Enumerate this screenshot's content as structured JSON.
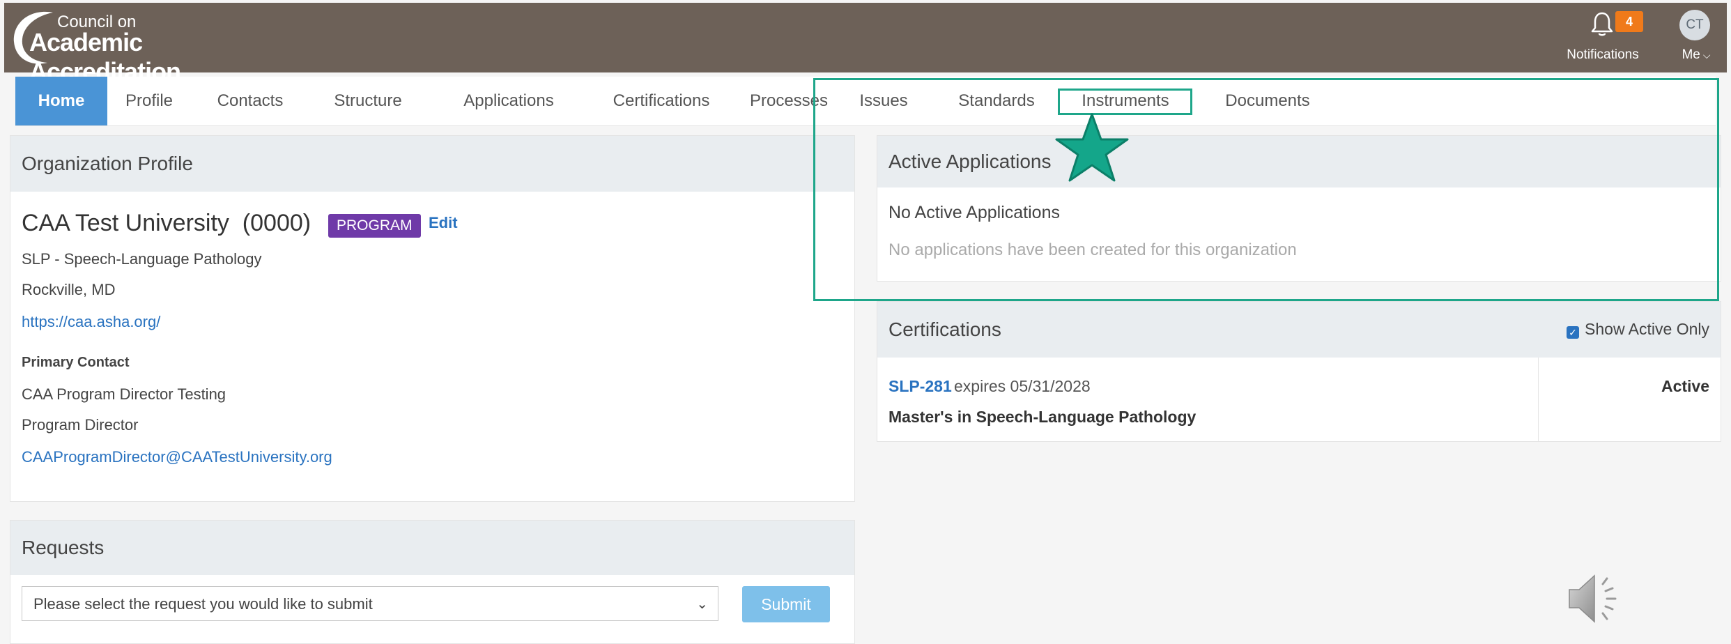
{
  "header": {
    "logo_line1": "Council on",
    "logo_line2": "Academic Accreditation",
    "notifications": {
      "count": "4",
      "label": "Notifications",
      "icon": "bell-icon"
    },
    "user": {
      "initials": "CT",
      "label": "Me"
    }
  },
  "nav": {
    "tabs": [
      {
        "label": "Home",
        "active": true
      },
      {
        "label": "Profile"
      },
      {
        "label": "Contacts"
      },
      {
        "label": "Structure"
      },
      {
        "label": "Applications"
      },
      {
        "label": "Certifications"
      },
      {
        "label": "Processes"
      },
      {
        "label": "Issues"
      },
      {
        "label": "Standards"
      },
      {
        "label": "Instruments"
      },
      {
        "label": "Documents"
      }
    ]
  },
  "org_profile": {
    "title": "Organization Profile",
    "name": "CAA Test University  (0000)",
    "badge": "PROGRAM",
    "edit_label": "Edit",
    "program": "SLP - Speech-Language Pathology",
    "location": "Rockville, MD",
    "url": "https://caa.asha.org/",
    "primary_contact_label": "Primary Contact",
    "contact_name": "CAA Program Director Testing",
    "contact_title": "Program Director",
    "contact_email": "CAAProgramDirector@CAATestUniversity.org"
  },
  "requests": {
    "title": "Requests",
    "select_value": "Please select the request you would like to submit",
    "submit_label": "Submit"
  },
  "active_applications": {
    "title": "Active Applications",
    "empty_title": "No Active Applications",
    "empty_text": "No applications have been created for this organization"
  },
  "certifications": {
    "title": "Certifications",
    "show_active_label": "Show Active Only",
    "show_active_checked": true,
    "items": [
      {
        "code": "SLP-281",
        "expires": "expires 05/31/2028",
        "name": "Master's in Speech-Language Pathology",
        "status": "Active"
      }
    ]
  },
  "colors": {
    "header_bg": "#6d6158",
    "nav_active": "#4a94d6",
    "badge_purple": "#6f3aa8",
    "notification_orange": "#f07a1a",
    "highlight_teal": "#1ea68a"
  }
}
